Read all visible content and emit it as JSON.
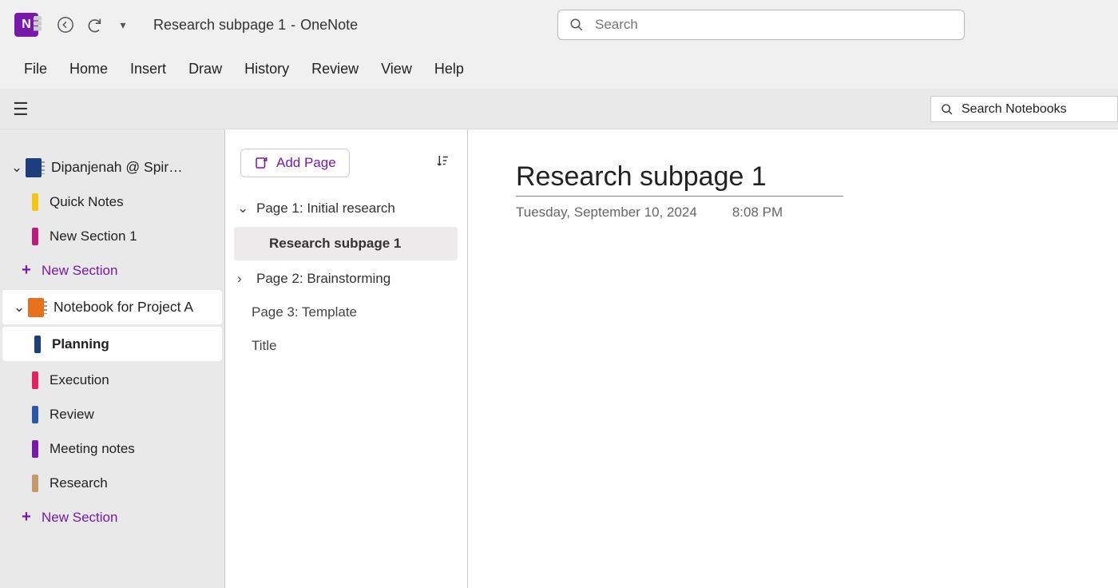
{
  "titlebar": {
    "app_letter": "N",
    "doc_title": "Research subpage 1",
    "separator": "-",
    "app_name": "OneNote",
    "search_placeholder": "Search"
  },
  "menu": [
    "File",
    "Home",
    "Insert",
    "Draw",
    "History",
    "Review",
    "View",
    "Help"
  ],
  "topstrip": {
    "search_notebooks_placeholder": "Search Notebooks"
  },
  "sidebar": {
    "notebook1": {
      "label": "Dipanjenah @ Spiral..."
    },
    "notebook1_sections": {
      "quick_notes": "Quick Notes",
      "new_section_1": "New Section 1",
      "new_section_btn": "New Section"
    },
    "notebook2": {
      "label": "Notebook for Project A"
    },
    "notebook2_sections": {
      "planning": "Planning",
      "execution": "Execution",
      "review": "Review",
      "meeting_notes": "Meeting notes",
      "research": "Research",
      "new_section_btn": "New Section"
    }
  },
  "page_col": {
    "add_page": "Add Page",
    "pages": {
      "p1": "Page 1: Initial research",
      "p1_sub": "Research subpage 1",
      "p2": "Page 2: Brainstorming",
      "p3": "Page 3: Template",
      "p4": "Title"
    }
  },
  "canvas": {
    "title": "Research subpage 1",
    "date": "Tuesday, September 10, 2024",
    "time": "8:08 PM"
  }
}
